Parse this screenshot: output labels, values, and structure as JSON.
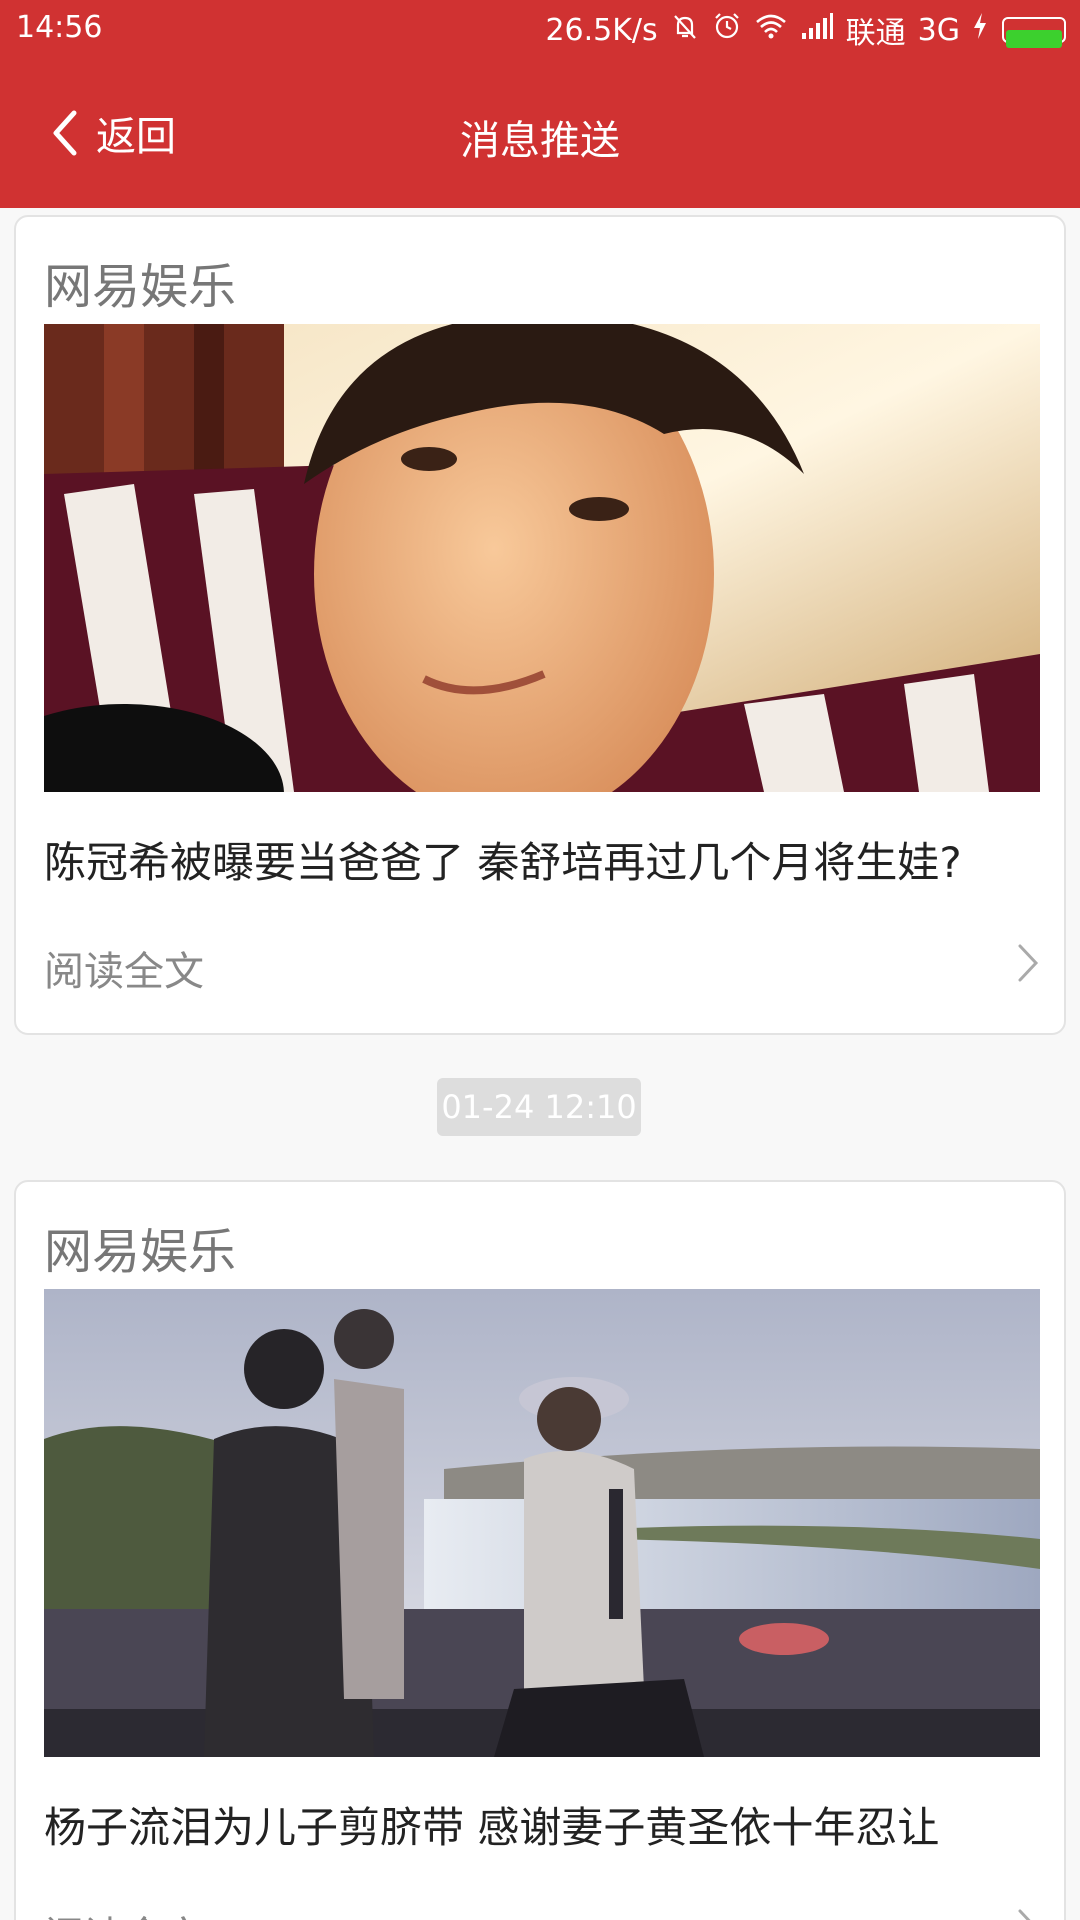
{
  "status_bar": {
    "time": "14:56",
    "network_speed": "26.5K/s",
    "carrier": "联通",
    "network_type": "3G",
    "icons": [
      "bell-off-icon",
      "alarm-icon",
      "wifi-icon",
      "signal-icon",
      "charging-icon",
      "battery-icon"
    ],
    "battery_color": "#3cd02e"
  },
  "header": {
    "back_label": "返回",
    "title": "消息推送",
    "background": "#d03232"
  },
  "messages": [
    {
      "source": "网易娱乐",
      "headline": "陈冠希被曝要当爸爸了 秦舒培再过几个月将生娃?",
      "read_more": "阅读全文"
    },
    {
      "source": "网易娱乐",
      "headline": "杨子流泪为儿子剪脐带 感谢妻子黄圣依十年忍让",
      "read_more": "阅读全文"
    }
  ],
  "timestamp": "01-24 12:10"
}
